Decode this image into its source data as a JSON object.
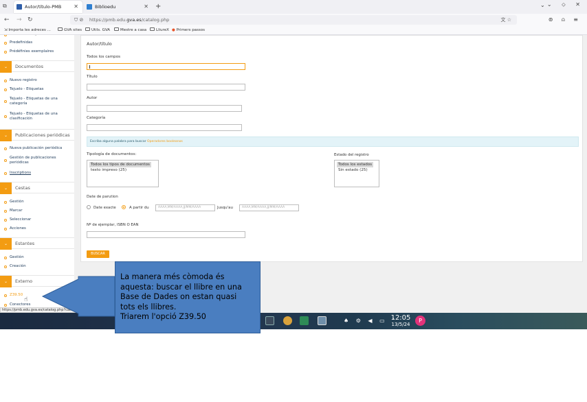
{
  "browser": {
    "tabs": [
      {
        "label": "Autor/título-PMB",
        "active": true,
        "favicon_color": "#2f5ea8"
      },
      {
        "label": "Biblioedu",
        "active": false,
        "favicon_color": "#2f7fd0"
      }
    ],
    "url_host_prefix": "https://pmb.edu.",
    "url_host_bold": "gva.es",
    "url_path": "/catalog.php",
    "bookmarks": [
      "Importa les adreces ...",
      "GVA sites",
      "Utils. GVA",
      "Mestre a casa",
      "LliureX",
      "Primers passos"
    ]
  },
  "sidebar": {
    "items_top": [
      "Predefinidas",
      "Prédéfinies exemplaires"
    ],
    "sections": [
      {
        "label": "Documentos",
        "items": [
          "Nuevo registro",
          "Tejuelo - Etiquetas",
          "Tejuelo - Etiquetas de una categoría",
          "Tejuelo - Etiquetas de una clasificación"
        ]
      },
      {
        "label": "Publicaciones periódicas",
        "items": [
          "Nueva publicación periódica",
          "Gestión de publicaciones periódicas",
          "Inscriptions"
        ]
      },
      {
        "label": "Cestas",
        "items": [
          "Gestión",
          "Marcar",
          "Seleccionar",
          "Acciones"
        ]
      },
      {
        "label": "Estantes",
        "items": [
          "Gestión",
          "Creación"
        ]
      },
      {
        "label": "Externo",
        "items": [
          "Z39.50",
          "Conectores"
        ]
      }
    ],
    "toggle_icon": "chevron-down-icon"
  },
  "form": {
    "title": "Autor/título",
    "all_fields_label": "Todos los campos",
    "title_label": "Título",
    "author_label": "Autor",
    "category_label": "Categoría",
    "info_text": "Escriba alguna palabra para buscar",
    "info_link": "Operadores booleanos",
    "doc_type_label": "Tipología de documentos:",
    "doc_type_options": [
      "Todos los tipos de documentos",
      "texto impreso (25)"
    ],
    "status_label": "Estado del registro",
    "status_options": [
      "Todos los estados",
      "Sin estado (25)"
    ],
    "date_label": "Date de parution",
    "radio_exact": "Date exacte",
    "radio_from": "A partir du",
    "date_placeholder": "AAAA,MM/AAAA,JJ/MM/AAAA",
    "until_label": "Jusqu'au",
    "isbn_label": "Nº de ejemplar, ISBN O EAN",
    "search_button": "BUSCAR"
  },
  "status_bar_url": "https://pmb.edu.gva.es/catalog.php?categ=z3950",
  "taskbar": {
    "time": "12:05",
    "date": "13/5/24",
    "avatar_initial": "P"
  },
  "callout": {
    "lines": [
      "La manera més còmoda és",
      "aquesta: buscar el llibre en una",
      "Base de Dades on estan quasi",
      "tots els llibres.",
      "Triarem l'opció Z39.50"
    ]
  },
  "colors": {
    "accent": "#f39c12",
    "callout": "#4a7ec0",
    "link": "#1f3b5a"
  }
}
